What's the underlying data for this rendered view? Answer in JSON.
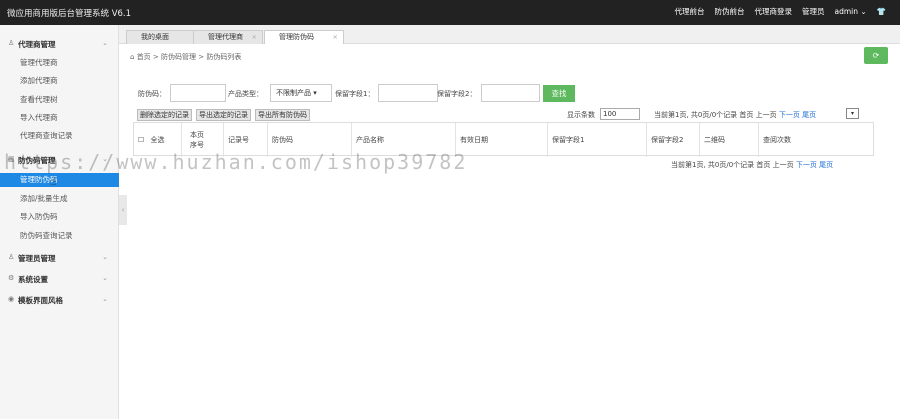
{
  "app": {
    "title": "微应用商用版后台管理系统 V6.1"
  },
  "topnav": {
    "item1": "代理前台",
    "item2": "防伪前台",
    "item3": "代理商登录",
    "admin_role": "管理员",
    "admin_name": "admin",
    "chevron": "chevron-down-icon",
    "shirt": "shirt-icon"
  },
  "sidebar": {
    "agent_group": "代理商管理",
    "agent_items": [
      "管理代理商",
      "添加代理商",
      "查看代理树",
      "导入代理商",
      "代理商查询记录"
    ],
    "code_group": "防伪码管理",
    "code_items": [
      "管理防伪码",
      "添加/批量生成",
      "导入防伪码",
      "防伪码查询记录"
    ],
    "admin_group": "管理员管理",
    "system_group": "系统设置",
    "theme_group": "模板界面风格"
  },
  "tabs": {
    "t1": "我的桌面",
    "t2": "管理代理商",
    "t3": "管理防伪码"
  },
  "breadcrumb": {
    "home": "首页",
    "sep": ">",
    "level1": "防伪码管理",
    "level2": "防伪码列表"
  },
  "search": {
    "code_label": "防伪码：",
    "type_label": "产品类型：",
    "type_selected": "不限制产品",
    "field1_label": "保留字段1：",
    "field2_label": "保留字段2：",
    "search_button": "查找"
  },
  "actions": {
    "delete_selected": "删除选定的记录",
    "export_selected": "导出选定的记录",
    "export_all": "导出所有防伪码"
  },
  "paging": {
    "size_label": "显示条数",
    "size_value": "100",
    "info": "当前第1页, 共0页/0个记录",
    "first": "首页",
    "prev": "上一页",
    "next": "下一页",
    "last": "尾页"
  },
  "table": {
    "headers": [
      "全选",
      "本页序号",
      "记录号",
      "防伪码",
      "产品名称",
      "有效日期",
      "保留字段1",
      "保留字段2",
      "二维码",
      "查阅次数"
    ]
  },
  "watermark": "https://www.huzhan.com/ishop39782",
  "colors": {
    "topbar": "#222222",
    "active": "#1e88e5",
    "green": "#5eb95e",
    "link": "#1e6fd9"
  }
}
